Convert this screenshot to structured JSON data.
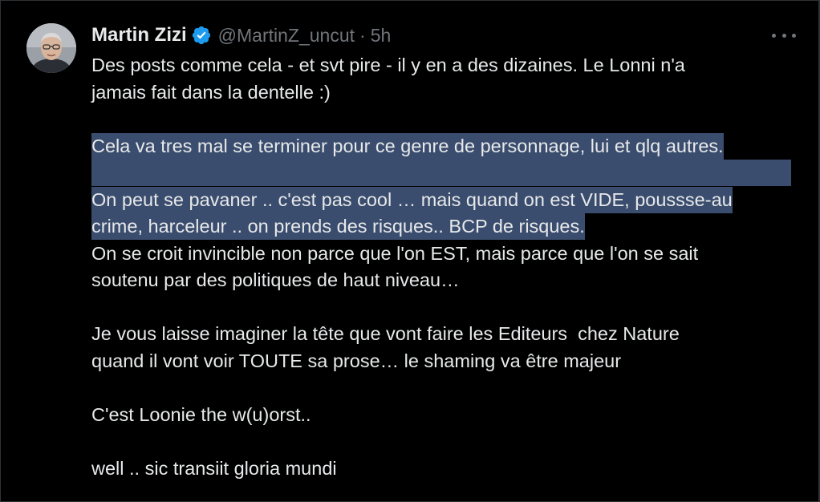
{
  "tweet": {
    "author_name": "Martin Zizi",
    "handle": "@MartinZ_uncut",
    "separator": "·",
    "timestamp": "5h",
    "more_label": "More",
    "lines": [
      "Des posts comme cela - et svt pire - il y en a des dizaines. Le Lonni n'a",
      "jamais fait dans la dentelle :)",
      "",
      "Cela va tres mal se terminer pour ce genre de personnage, lui et qlq autres.",
      "",
      "On peut se pavaner .. c'est pas cool … mais quand on est VIDE, poussse-au",
      "crime, harceleur .. on prends des risques.. BCP de risques.",
      "On se croit invincible non parce que l'on EST, mais parce que l'on se sait",
      "soutenu par des politiques de haut niveau…",
      "",
      "Je vous laisse imaginer la tête que vont faire les Editeurs  chez Nature",
      "quand il vont voir TOUTE sa prose… le shaming va être majeur",
      "",
      "C'est Loonie the w(u)orst..",
      "",
      "well .. sic transiit gloria mundi"
    ]
  },
  "colors": {
    "background": "#000000",
    "text": "#e7e9ea",
    "secondary_text": "#71767b",
    "verified_badge": "#1d9bf0",
    "selection_highlight": "#3b4d6e"
  },
  "icons": {
    "verified": "verified-badge-icon",
    "more": "more-horizontal-icon"
  }
}
